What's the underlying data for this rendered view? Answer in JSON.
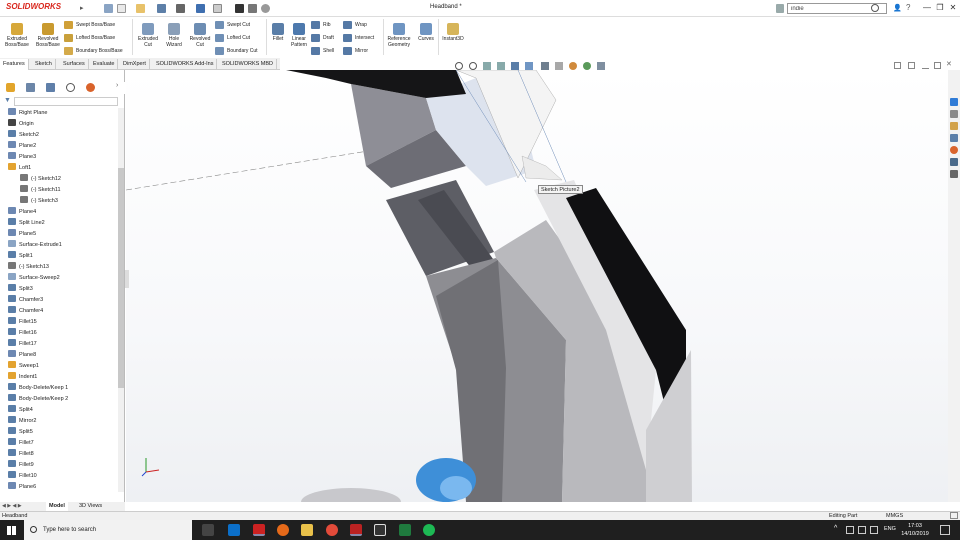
{
  "window": {
    "app_name": "SOLIDWORKS",
    "doc_title": "Headband *",
    "search_value": "indie",
    "controls": [
      "—",
      "❐",
      "✕"
    ]
  },
  "command_manager": {
    "features": [
      {
        "label": "Extruded Boss/Base"
      },
      {
        "label": "Revolved Boss/Base"
      },
      {
        "label": "Extruded Cut"
      },
      {
        "label": "Hole Wizard"
      },
      {
        "label": "Revolved Cut"
      },
      {
        "label": "Fillet"
      },
      {
        "label": "Linear Pattern"
      },
      {
        "label": "Reference Geometry"
      },
      {
        "label": "Curves"
      },
      {
        "label": "Instant3D"
      }
    ],
    "small": [
      {
        "label": "Swept Boss/Base"
      },
      {
        "label": "Lofted Boss/Base"
      },
      {
        "label": "Boundary Boss/Base"
      },
      {
        "label": "Swept Cut"
      },
      {
        "label": "Lofted Cut"
      },
      {
        "label": "Boundary Cut"
      },
      {
        "label": "Rib"
      },
      {
        "label": "Draft"
      },
      {
        "label": "Shell"
      },
      {
        "label": "Wrap"
      },
      {
        "label": "Intersect"
      },
      {
        "label": "Mirror"
      }
    ]
  },
  "tabs": [
    "Features",
    "Sketch",
    "Surfaces",
    "Evaluate",
    "DimXpert",
    "SOLIDWORKS Add-Ins",
    "SOLIDWORKS MBD"
  ],
  "active_tab": "Features",
  "tree": [
    "Right Plane",
    "Origin",
    "Sketch2",
    "Plane2",
    "Plane3",
    "Loft1",
    "(-) Sketch12",
    "(-) Sketch11",
    "(-) Sketch3",
    "Plane4",
    "Split Line2",
    "Plane5",
    "Surface-Extrude1",
    "Split1",
    "(-) Sketch13",
    "Surface-Sweep2",
    "Split3",
    "Chamfer3",
    "Chamfer4",
    "Fillet15",
    "Fillet16",
    "Fillet17",
    "Plane8",
    "Sweep1",
    "Indent1",
    "Body-Delete/Keep 1",
    "Body-Delete/Keep 2",
    "Split4",
    "Mirror2",
    "Split5",
    "Fillet7",
    "Fillet8",
    "Fillet9",
    "Fillet10",
    "Plane6"
  ],
  "tooltip": "Sketch Picture2",
  "bottom_tabs": [
    "Model",
    "3D Views"
  ],
  "status": {
    "left": "Headband",
    "mode": "Editing Part",
    "units": "MMGS"
  },
  "taskbar": {
    "search_placeholder": "Type here to search",
    "lang": "ENG",
    "time": "17:03",
    "date": "14/10/2019"
  },
  "colors": {
    "brand_red": "#d9261c",
    "taskbar": "#1f1f1f",
    "accent_blue": "#2f7bd6"
  }
}
